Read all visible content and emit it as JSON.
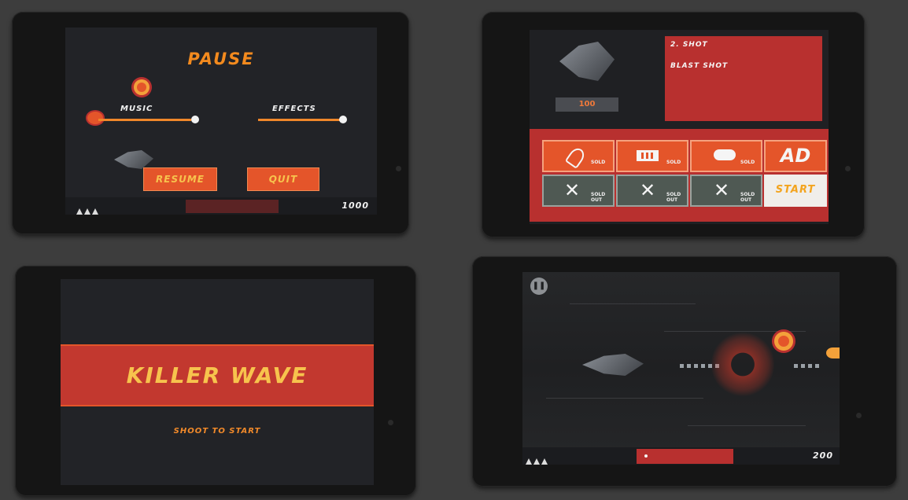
{
  "pause_screen": {
    "title": "PAUSE",
    "music_label": "MUSIC",
    "effects_label": "EFFECTS",
    "music_level": 1.0,
    "effects_level": 1.0,
    "resume_label": "RESUME",
    "quit_label": "QUIT",
    "score": "1000",
    "lives": 3
  },
  "shop_screen": {
    "item_title": "2. SHOT",
    "item_description": "BLAST SHOT",
    "price": "100",
    "row1": [
      {
        "icon": "rocket-icon",
        "status": "SOLD"
      },
      {
        "icon": "battery-icon",
        "status": "SOLD"
      },
      {
        "icon": "pill-icon",
        "status": "SOLD"
      }
    ],
    "row2": [
      {
        "icon": "cross-icon",
        "status": "SOLD OUT"
      },
      {
        "icon": "cross-icon",
        "status": "SOLD OUT"
      },
      {
        "icon": "cross-icon",
        "status": "SOLD OUT"
      }
    ],
    "ad_label": "AD",
    "start_label": "START"
  },
  "title_screen": {
    "game_title": "KILLER WAVE",
    "prompt": "SHOOT TO START"
  },
  "gameplay_screen": {
    "score": "200",
    "lives": 3
  },
  "colors": {
    "accent_orange": "#f38a1e",
    "button_red": "#e4552a",
    "panel_red": "#b8302f",
    "yellow_text": "#f7c34d"
  }
}
